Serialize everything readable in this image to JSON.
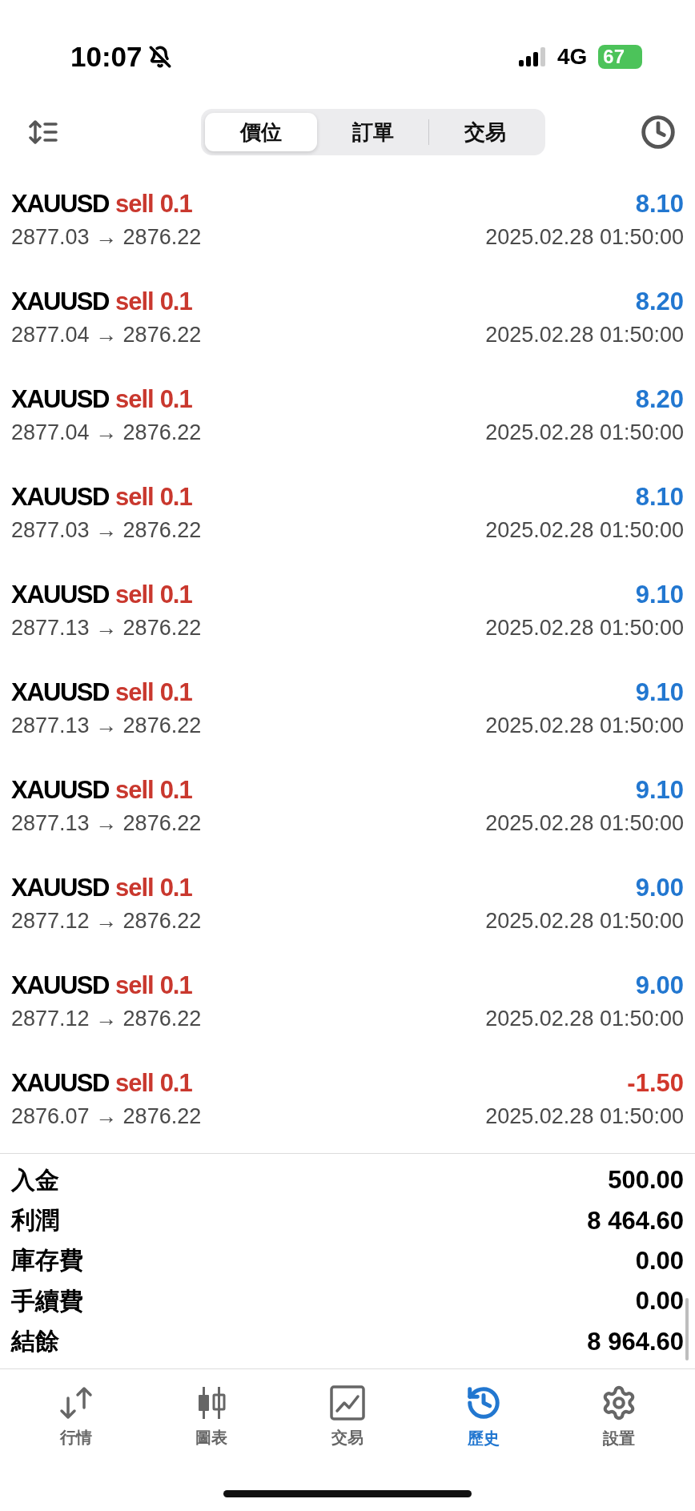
{
  "status_bar": {
    "time": "10:07",
    "silent": true,
    "network": "4G",
    "battery": "67"
  },
  "segments": [
    {
      "label": "價位",
      "selected": true
    },
    {
      "label": "訂單",
      "selected": false
    },
    {
      "label": "交易",
      "selected": false
    }
  ],
  "deals": [
    {
      "symbol": "XAUUSD",
      "side": "sell",
      "volume": "0.1",
      "profit": "8.10",
      "color": "#2277d0",
      "prices": "2877.03 → 2876.22",
      "time": "2025.02.28 01:50:00"
    },
    {
      "symbol": "XAUUSD",
      "side": "sell",
      "volume": "0.1",
      "profit": "8.20",
      "color": "#2277d0",
      "prices": "2877.04 → 2876.22",
      "time": "2025.02.28 01:50:00"
    },
    {
      "symbol": "XAUUSD",
      "side": "sell",
      "volume": "0.1",
      "profit": "8.20",
      "color": "#2277d0",
      "prices": "2877.04 → 2876.22",
      "time": "2025.02.28 01:50:00"
    },
    {
      "symbol": "XAUUSD",
      "side": "sell",
      "volume": "0.1",
      "profit": "8.10",
      "color": "#2277d0",
      "prices": "2877.03 → 2876.22",
      "time": "2025.02.28 01:50:00"
    },
    {
      "symbol": "XAUUSD",
      "side": "sell",
      "volume": "0.1",
      "profit": "9.10",
      "color": "#2277d0",
      "prices": "2877.13 → 2876.22",
      "time": "2025.02.28 01:50:00"
    },
    {
      "symbol": "XAUUSD",
      "side": "sell",
      "volume": "0.1",
      "profit": "9.10",
      "color": "#2277d0",
      "prices": "2877.13 → 2876.22",
      "time": "2025.02.28 01:50:00"
    },
    {
      "symbol": "XAUUSD",
      "side": "sell",
      "volume": "0.1",
      "profit": "9.10",
      "color": "#2277d0",
      "prices": "2877.13 → 2876.22",
      "time": "2025.02.28 01:50:00"
    },
    {
      "symbol": "XAUUSD",
      "side": "sell",
      "volume": "0.1",
      "profit": "9.00",
      "color": "#2277d0",
      "prices": "2877.12 → 2876.22",
      "time": "2025.02.28 01:50:00"
    },
    {
      "symbol": "XAUUSD",
      "side": "sell",
      "volume": "0.1",
      "profit": "9.00",
      "color": "#2277d0",
      "prices": "2877.12 → 2876.22",
      "time": "2025.02.28 01:50:00"
    },
    {
      "symbol": "XAUUSD",
      "side": "sell",
      "volume": "0.1",
      "profit": "-1.50",
      "color": "#d1382c",
      "prices": "2876.07 → 2876.22",
      "time": "2025.02.28 01:50:00"
    }
  ],
  "summary": [
    {
      "label": "入金",
      "value": "500.00"
    },
    {
      "label": "利潤",
      "value": "8 464.60"
    },
    {
      "label": "庫存費",
      "value": "0.00"
    },
    {
      "label": "手續費",
      "value": "0.00"
    },
    {
      "label": "結餘",
      "value": "8 964.60"
    }
  ],
  "tab_bar": [
    {
      "kind": "quotes",
      "label": "行情",
      "selected": false
    },
    {
      "kind": "chart",
      "label": "圖表",
      "selected": false
    },
    {
      "kind": "trade",
      "label": "交易",
      "selected": false
    },
    {
      "kind": "history",
      "label": "歷史",
      "selected": true
    },
    {
      "kind": "settings",
      "label": "設置",
      "selected": false
    }
  ]
}
